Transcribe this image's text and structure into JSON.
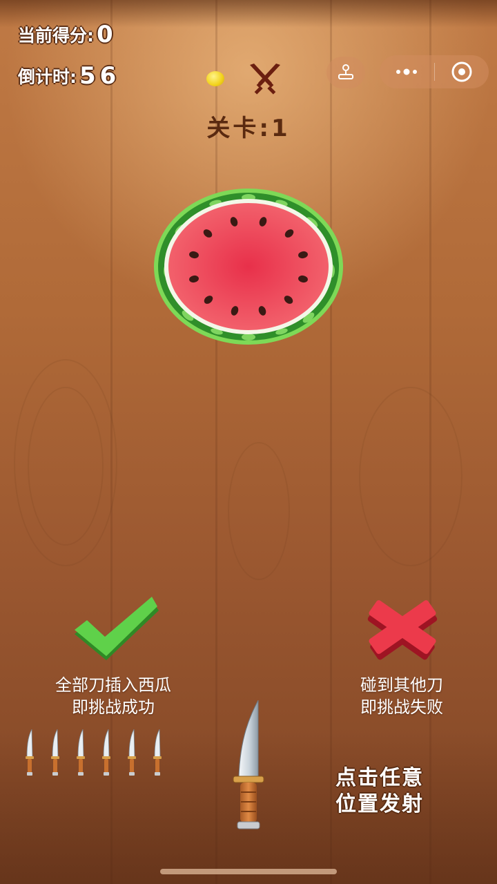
{
  "hud": {
    "score_label": "当前得分:",
    "score_value": "0",
    "timer_label": "倒计时:",
    "timer_value": "56"
  },
  "level": {
    "label": "关卡:1"
  },
  "mini_program_capsule": {
    "more_icon": "more-dots-icon",
    "close_icon": "target-close-icon"
  },
  "rules": {
    "success_line1": "全部刀插入西瓜",
    "success_line2": "即挑战成功",
    "fail_line1": "碰到其他刀",
    "fail_line2": "即挑战失败"
  },
  "knives_remaining": 6,
  "hint": {
    "line1": "点击任意",
    "line2": "位置发射"
  },
  "colors": {
    "wood": "#b06a38",
    "melon_flesh": "#ef4e5c",
    "melon_rind": "#3fa83a",
    "check": "#4cc23c",
    "cross": "#e0283c"
  }
}
